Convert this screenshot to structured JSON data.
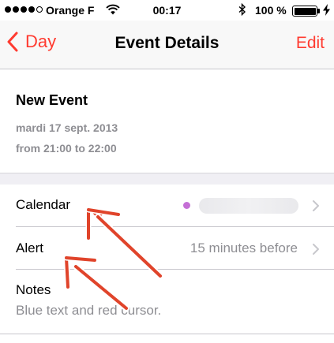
{
  "status_bar": {
    "carrier": "Orange F",
    "time": "00:17",
    "battery_percent": "100 %",
    "signal_bars_filled": 4,
    "signal_bars_total": 5,
    "battery_level": 1.0,
    "icons": [
      "wifi-icon",
      "bluetooth-icon",
      "battery-icon",
      "charging-bolt-icon"
    ]
  },
  "nav": {
    "back_label": "Day",
    "title": "Event Details",
    "edit_label": "Edit",
    "accent_color": "#ff3b30"
  },
  "event": {
    "title": "New Event",
    "date": "mardi 17 sept. 2013",
    "time": "from 21:00 to 22:00"
  },
  "rows": {
    "calendar": {
      "label": "Calendar",
      "dot_color": "#c56fd6"
    },
    "alert": {
      "label": "Alert",
      "value": "15 minutes before"
    },
    "notes": {
      "label": "Notes",
      "text": "Blue text and red cursor."
    }
  },
  "annotations": {
    "arrow_color": "#e0442b",
    "count": 2
  }
}
